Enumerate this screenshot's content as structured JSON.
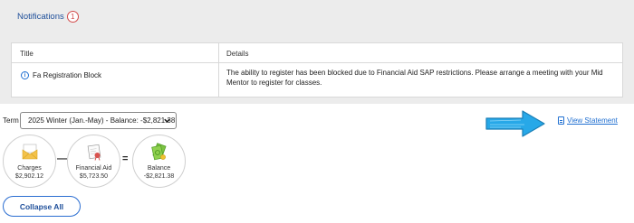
{
  "notifications": {
    "title": "Notifications",
    "count": "1",
    "columns": {
      "title": "Title",
      "details": "Details"
    },
    "rows": [
      {
        "title": "Fa Registration Block",
        "details": "The ability to register has been blocked due to Financial Aid SAP restrictions. Please arrange a meeting with your Mid Mentor to register for classes."
      }
    ]
  },
  "term": {
    "label": "Term",
    "selected": "2025 Winter (Jan.-May) - Balance: -$2,821.38"
  },
  "summary": {
    "charges": {
      "label": "Charges",
      "amount": "$2,902.12",
      "icon": "envelope-icon"
    },
    "operator_minus": "—",
    "financial_aid": {
      "label": "Financial Aid",
      "amount": "$5,723.50",
      "icon": "certificate-icon"
    },
    "operator_equals": "=",
    "balance": {
      "label": "Balance",
      "amount": "-$2,821.38",
      "icon": "money-icon"
    }
  },
  "statement": {
    "label": "View Statement",
    "icon": "document-icon"
  },
  "collapse": {
    "label": "Collapse All"
  },
  "colors": {
    "accent": "#1f4f9a",
    "link": "#1f6fd1",
    "badge": "#d24a4a",
    "arrow": "#27a8e8"
  }
}
